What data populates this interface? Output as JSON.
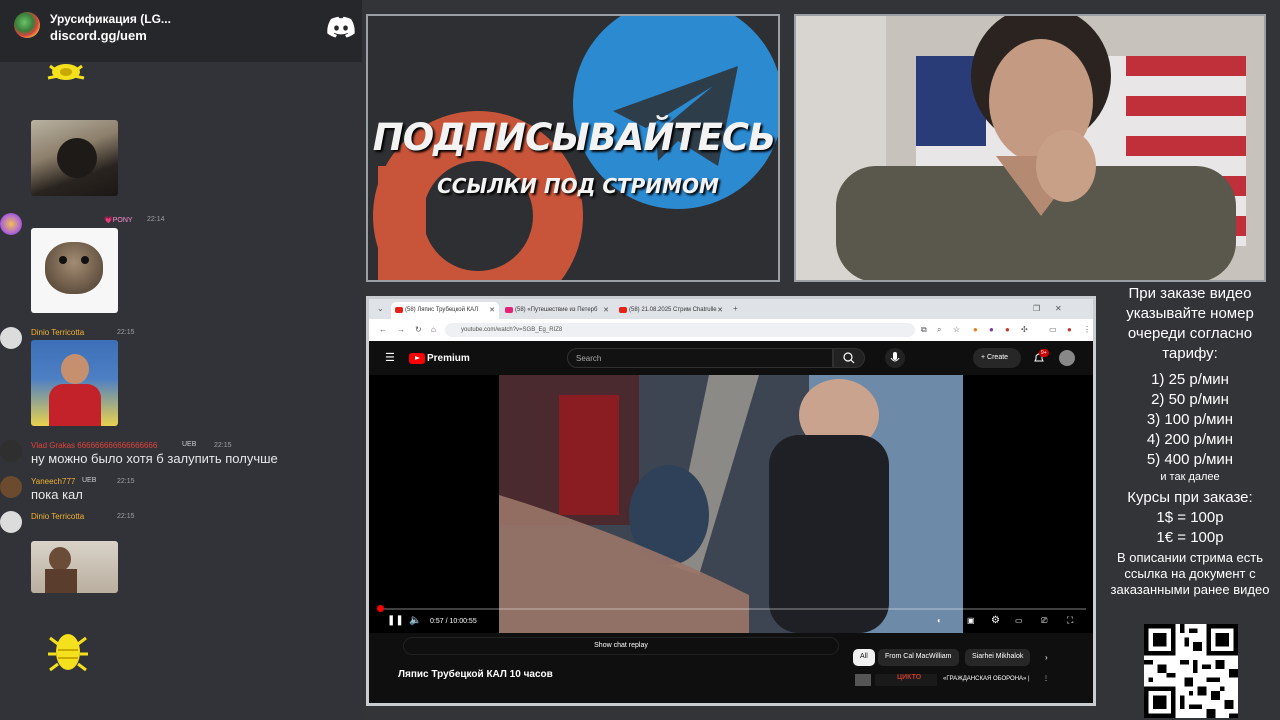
{
  "discord": {
    "server_title": "Урусификация (LG...",
    "server_invite": "discord.gg/uem",
    "messages": [
      {
        "author": "",
        "badge": "💗PONY",
        "time": "22:14"
      },
      {
        "author": "Dinio Terricotta",
        "badge": "",
        "time": "22:15"
      },
      {
        "author": "Vlad Grakas 666666666666666666",
        "badge": "UEB",
        "time": "22:15",
        "text": "ну можно было хотя б залупить получше"
      },
      {
        "author": "Yaneech777",
        "badge": "UEB",
        "time": "22:15",
        "text": "пока кал"
      },
      {
        "author": "Dinio Terricotta",
        "badge": "",
        "time": "22:15"
      }
    ],
    "colors": {
      "username_gold": "#f0b232",
      "username_red": "#e0433c",
      "bg": "#323338"
    }
  },
  "promo": {
    "line1": "ПОДПИСЫВАЙТЕСЬ",
    "line2": "ССЫЛКИ ПОД СТРИМОМ",
    "colors": {
      "patreon": "#c8553a",
      "telegram": "#2c8ad1"
    }
  },
  "browser": {
    "tabs": [
      {
        "label": "(58) Ляпис Трубецкой КАЛ"
      },
      {
        "label": "(58) «Путешествие из Петерб"
      },
      {
        "label": "(58) 21.08.2025 Стрим Chatrulle"
      }
    ],
    "url": "youtube.com/watch?v=SGB_Eg_RIZ8",
    "youtube": {
      "brand": "Premium",
      "search_placeholder": "Search",
      "create_label": "Create",
      "notif_badge": "9+",
      "time": "0:57 / 10:00:55",
      "progress": 0.0016,
      "show_chat_replay": "Show chat replay",
      "video_title": "Ляпис Трубецкой КАЛ 10 часов",
      "chips": [
        "All",
        "From Cal MacWilliam",
        "Siarhei Mikhalok"
      ],
      "recommended_title": "«ГРАЖДАНСКАЯ ОБОРОНА» |",
      "recommended_thumb_text": "ЦИКТО"
    }
  },
  "info": {
    "order_heading": "При заказе видео указывайте номер очереди согласно тарифу:",
    "tariffs": [
      "1) 25 р/мин",
      "2) 50 р/мин",
      "3) 100 р/мин",
      "4) 200 р/мин",
      "5) 400 р/мин"
    ],
    "etc": "и так далее",
    "rates_heading": "Курсы при заказе:",
    "rates": [
      "1$ = 100р",
      "1€ = 100р"
    ],
    "note": "В описании стрима есть ссылка на документ с заказанными ранее видео"
  }
}
